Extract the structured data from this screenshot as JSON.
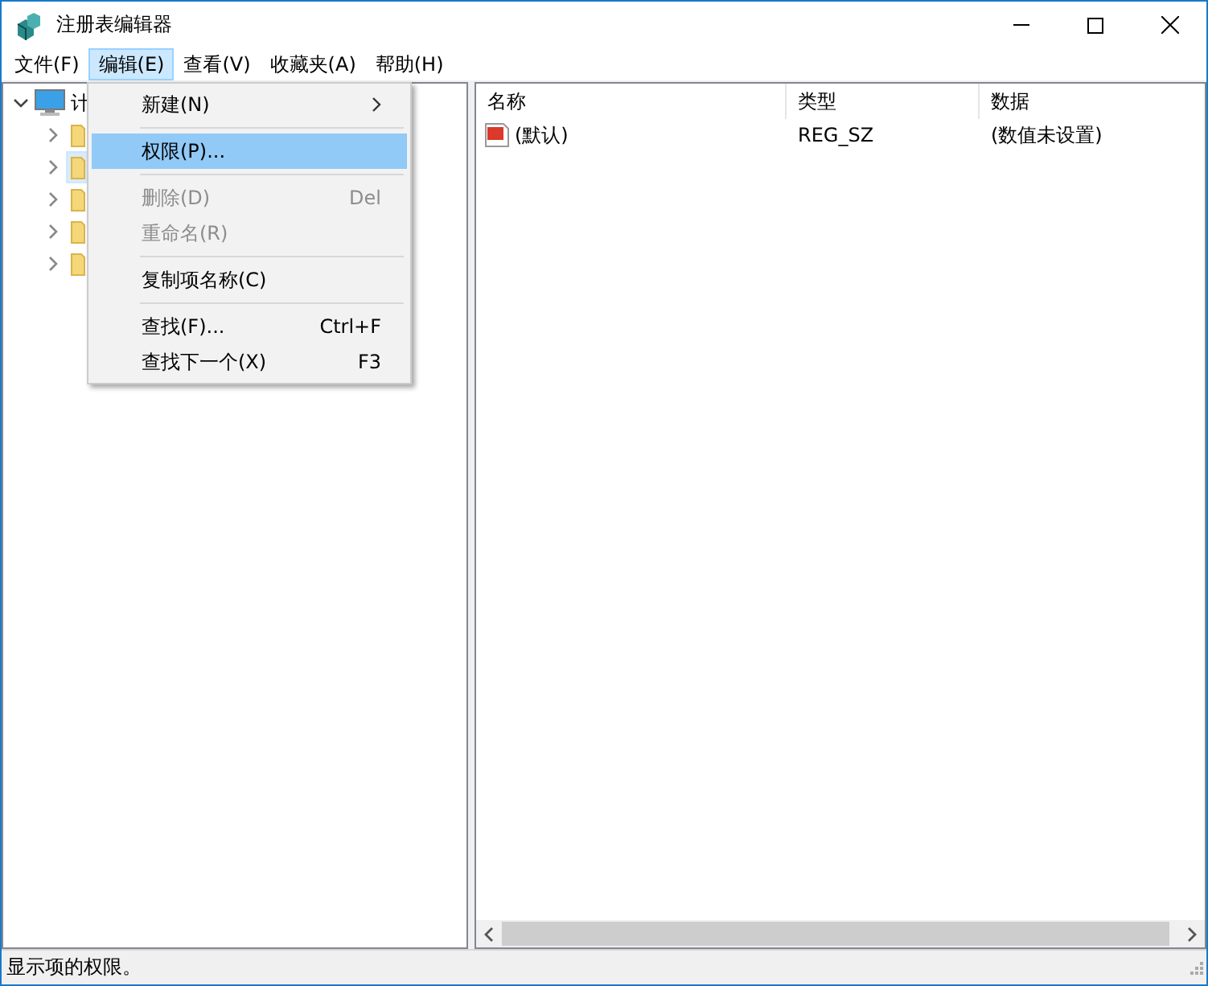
{
  "window": {
    "title": "注册表编辑器"
  },
  "menu_bar": [
    {
      "label": "文件(F)",
      "selected": false
    },
    {
      "label": "编辑(E)",
      "selected": true
    },
    {
      "label": "查看(V)",
      "selected": false
    },
    {
      "label": "收藏夹(A)",
      "selected": false
    },
    {
      "label": "帮助(H)",
      "selected": false
    }
  ],
  "tree": {
    "root": {
      "label": "计",
      "expanded": true,
      "children": [
        {
          "selected": false
        },
        {
          "selected": true
        },
        {
          "selected": false
        },
        {
          "selected": false
        },
        {
          "selected": false
        }
      ]
    }
  },
  "dropdown_menu": [
    {
      "kind": "item",
      "label": "新建(N)",
      "submenu": true,
      "disabled": false,
      "selected": false
    },
    {
      "kind": "separator"
    },
    {
      "kind": "item",
      "label": "权限(P)...",
      "disabled": false,
      "selected": true
    },
    {
      "kind": "separator"
    },
    {
      "kind": "item",
      "label": "删除(D)",
      "shortcut": "Del",
      "disabled": true,
      "selected": false
    },
    {
      "kind": "item",
      "label": "重命名(R)",
      "disabled": true,
      "selected": false
    },
    {
      "kind": "separator"
    },
    {
      "kind": "item",
      "label": "复制项名称(C)",
      "disabled": false,
      "selected": false
    },
    {
      "kind": "separator"
    },
    {
      "kind": "item",
      "label": "查找(F)...",
      "shortcut": "Ctrl+F",
      "disabled": false,
      "selected": false
    },
    {
      "kind": "item",
      "label": "查找下一个(X)",
      "shortcut": "F3",
      "disabled": false,
      "selected": false
    }
  ],
  "table": {
    "columns": [
      "名称",
      "类型",
      "数据"
    ],
    "rows": [
      {
        "name": "(默认)",
        "type": "REG_SZ",
        "data": "(数值未设置)"
      }
    ]
  },
  "status_bar": "显示项的权限。"
}
